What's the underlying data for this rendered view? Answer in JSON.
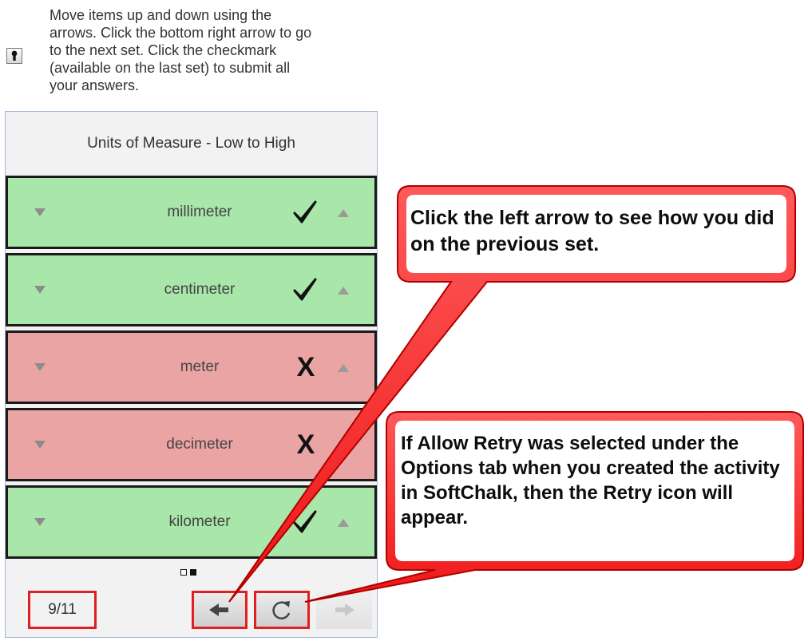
{
  "instructions": {
    "icon": "keyhole-icon",
    "lines": [
      "Move items up and down using the",
      "arrows. Click the bottom right arrow to go",
      "to the next set. Click the checkmark",
      "(available on the last set) to submit all",
      "your answers."
    ]
  },
  "widget": {
    "title": "Units of Measure - Low to High",
    "items": [
      {
        "label": "millimeter",
        "status": "correct"
      },
      {
        "label": "centimeter",
        "status": "correct"
      },
      {
        "label": "meter",
        "status": "wrong"
      },
      {
        "label": "decimeter",
        "status": "wrong"
      },
      {
        "label": "kilometer",
        "status": "correct"
      }
    ],
    "wrong_mark": "X",
    "pager": {
      "total_sets": 2,
      "current_set": 2
    },
    "counter": "9/11",
    "buttons": {
      "previous": {
        "icon": "left-arrow-icon",
        "enabled": true
      },
      "retry": {
        "icon": "retry-icon",
        "enabled": true
      },
      "next": {
        "icon": "right-arrow-icon",
        "enabled": false
      }
    }
  },
  "callouts": {
    "previous": "Click the left arrow to see how you did on the previous set.",
    "retry": "If Allow Retry was selected under the Options tab when you created the activity in SoftChalk, then the Retry icon will appear."
  },
  "colors": {
    "correct_bg": "#a9e6a9",
    "wrong_bg": "#eba4a4",
    "callout_fill": "#ff2e2e",
    "highlight_border": "#e02020",
    "widget_border": "#9fb7d6"
  }
}
